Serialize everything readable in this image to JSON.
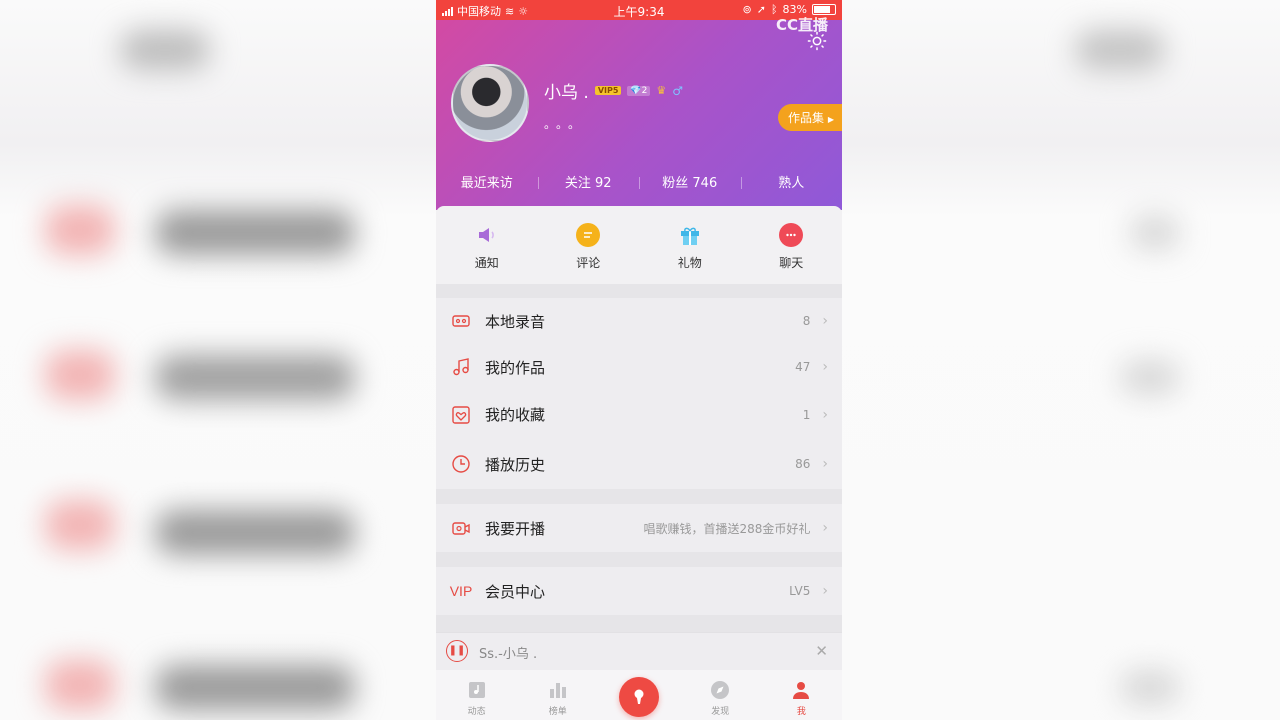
{
  "status_bar": {
    "carrier": "中国移动",
    "time": "上午9:34",
    "battery": "83%"
  },
  "watermark": "CC直播",
  "profile": {
    "name": "小乌 .",
    "vip_badge": "VIP5",
    "diamond_level": "2",
    "signature": "。。。",
    "works_button": "作品集"
  },
  "stats": [
    {
      "label": "最近来访"
    },
    {
      "label": "关注 92"
    },
    {
      "label": "粉丝 746"
    },
    {
      "label": "熟人"
    }
  ],
  "quick_actions": [
    {
      "label": "通知",
      "icon": "speaker-icon",
      "color": "#a86ad8"
    },
    {
      "label": "评论",
      "icon": "comment-icon",
      "color": "#f5b21a"
    },
    {
      "label": "礼物",
      "icon": "gift-icon",
      "color": "#3fb7e8"
    },
    {
      "label": "聊天",
      "icon": "chat-icon",
      "color": "#ef4a57"
    }
  ],
  "menu": [
    {
      "label": "本地录音",
      "value": "8",
      "icon": "cassette-icon"
    },
    {
      "label": "我的作品",
      "value": "47",
      "icon": "music-note-icon"
    },
    {
      "label": "我的收藏",
      "value": "1",
      "icon": "heart-icon"
    },
    {
      "label": "播放历史",
      "value": "86",
      "icon": "clock-icon"
    },
    {
      "label": "我要开播",
      "value": "唱歌赚钱，首播送288金币好礼",
      "icon": "video-camera-icon"
    },
    {
      "label": "会员中心",
      "value": "LV5",
      "icon": "vip-icon",
      "icon_text": "VIP"
    }
  ],
  "now_playing": {
    "title": "Ss.-小乌 ."
  },
  "tabs": [
    {
      "label": "动态"
    },
    {
      "label": "榜单"
    },
    {
      "label": ""
    },
    {
      "label": "发现"
    },
    {
      "label": "我"
    }
  ],
  "accent_color": "#e64b44"
}
